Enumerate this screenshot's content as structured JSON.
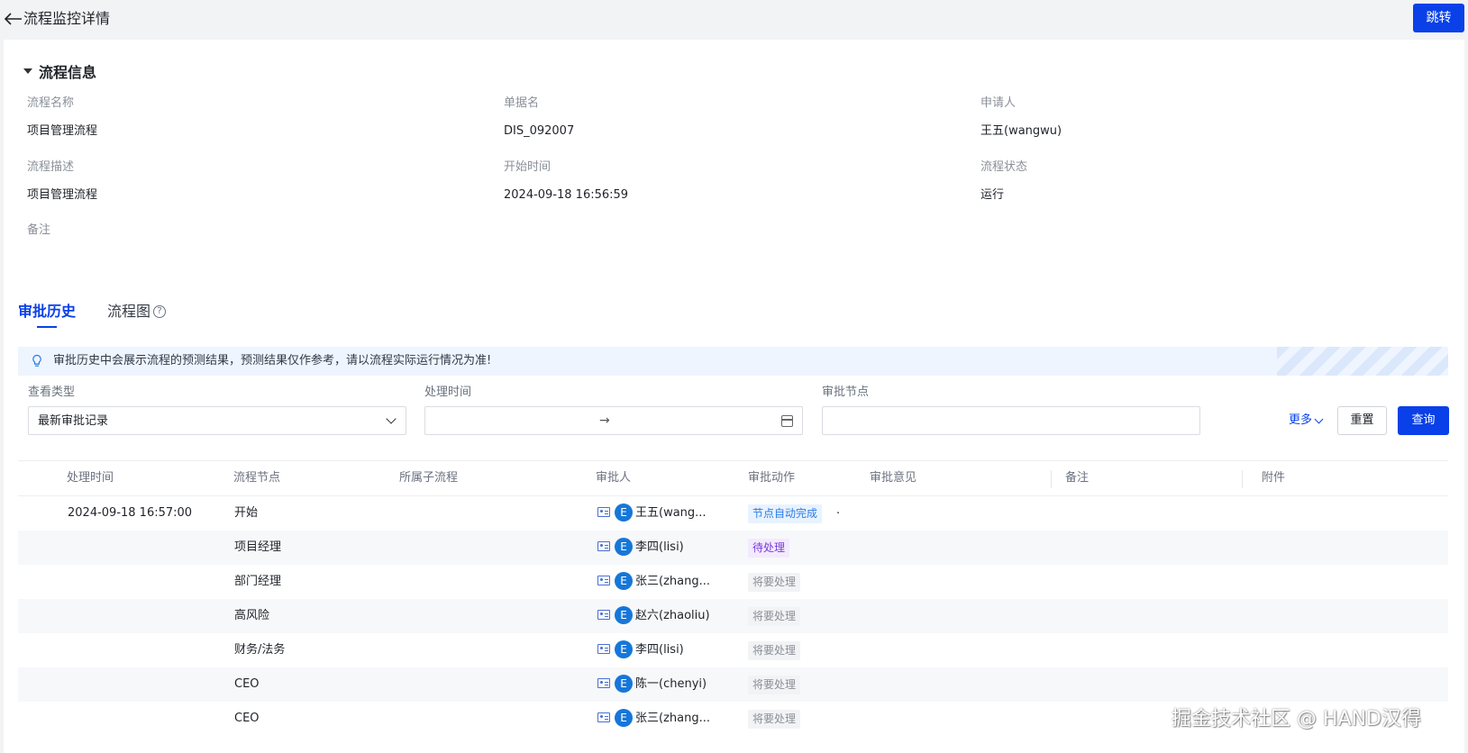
{
  "header": {
    "title": "流程监控详情",
    "jump_label": "跳转"
  },
  "process_info": {
    "section_title": "流程信息",
    "fields": [
      {
        "label": "流程名称",
        "value": "项目管理流程"
      },
      {
        "label": "单据名",
        "value": "DIS_092007"
      },
      {
        "label": "申请人",
        "value": "王五(wangwu)"
      },
      {
        "label": "流程描述",
        "value": "项目管理流程"
      },
      {
        "label": "开始时间",
        "value": "2024-09-18 16:56:59"
      },
      {
        "label": "流程状态",
        "value": "运行"
      },
      {
        "label": "备注",
        "value": ""
      }
    ]
  },
  "tabs": [
    {
      "label": "审批历史",
      "active": true
    },
    {
      "label": "流程图",
      "help_icon": "?",
      "active": false
    }
  ],
  "notice": {
    "icon": "bulb-icon",
    "text": "审批历史中会展示流程的预测结果，预测结果仅作参考，请以流程实际运行情况为准!"
  },
  "filters": {
    "view_type": {
      "label": "查看类型",
      "value": "最新审批记录"
    },
    "process_time": {
      "label": "处理时间",
      "separator": "→"
    },
    "approval_node": {
      "label": "审批节点",
      "value": ""
    },
    "more_label": "更多",
    "reset_label": "重置",
    "query_label": "查询"
  },
  "table": {
    "columns": [
      "处理时间",
      "流程节点",
      "所属子流程",
      "审批人",
      "审批动作",
      "审批意见",
      "备注",
      "附件"
    ],
    "rows": [
      {
        "time": "2024-09-18 16:57:00",
        "node": "开始",
        "subprocess": "",
        "avatar": "E",
        "approver": "王五(wang...",
        "action": "节点自动完成",
        "status": "done",
        "opinion": "."
      },
      {
        "time": "",
        "node": "项目经理",
        "subprocess": "",
        "avatar": "E",
        "approver": "李四(lisi)",
        "action": "待处理",
        "status": "pending",
        "opinion": ""
      },
      {
        "time": "",
        "node": "部门经理",
        "subprocess": "",
        "avatar": "E",
        "approver": "张三(zhang...",
        "action": "将要处理",
        "status": "future",
        "opinion": ""
      },
      {
        "time": "",
        "node": "高风险",
        "subprocess": "",
        "avatar": "E",
        "approver": "赵六(zhaoliu)",
        "action": "将要处理",
        "status": "future",
        "opinion": ""
      },
      {
        "time": "",
        "node": "财务/法务",
        "subprocess": "",
        "avatar": "E",
        "approver": "李四(lisi)",
        "action": "将要处理",
        "status": "future",
        "opinion": ""
      },
      {
        "time": "",
        "node": "CEO",
        "subprocess": "",
        "avatar": "E",
        "approver": "陈一(chenyi)",
        "action": "将要处理",
        "status": "future",
        "opinion": ""
      },
      {
        "time": "",
        "node": "CEO",
        "subprocess": "",
        "avatar": "E",
        "approver": "张三(zhang...",
        "action": "将要处理",
        "status": "future",
        "opinion": ""
      }
    ]
  },
  "watermark": "掘金技术社区 @ HAND汉得",
  "colors": {
    "primary": "#0a40e8",
    "tag_done": "#2c7be5",
    "tag_pending": "#7a3bd6",
    "tag_future": "#8a8f98",
    "avatar": "#1677d9"
  }
}
